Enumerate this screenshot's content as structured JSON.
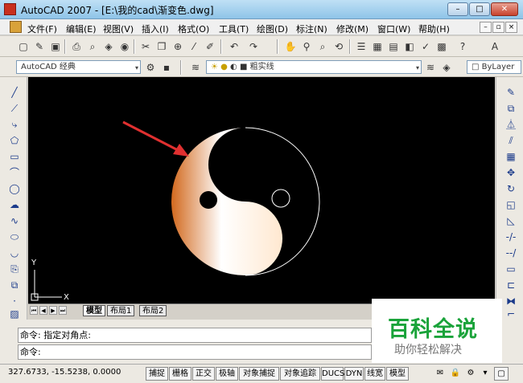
{
  "window": {
    "title": "AutoCAD 2007 - [E:\\我的cad\\渐变色.dwg]",
    "min_label": "–",
    "max_label": "□",
    "close_label": "✕"
  },
  "menu": [
    "文件(F)",
    "编辑(E)",
    "视图(V)",
    "插入(I)",
    "格式(O)",
    "工具(T)",
    "绘图(D)",
    "标注(N)",
    "修改(M)",
    "窗口(W)",
    "帮助(H)"
  ],
  "toolbar2": {
    "workspace": "AutoCAD 经典",
    "layer": "粗实线",
    "color": "ByLayer"
  },
  "tabs": [
    "模型",
    "布局1",
    "布局2"
  ],
  "ucs": {
    "y": "Y",
    "x": "X"
  },
  "command": {
    "history": "命令: 指定对角点:",
    "prompt": "命令:"
  },
  "status": {
    "coords": "327.6733,  -15.5238,  0.0000",
    "buttons": [
      "捕捉",
      "栅格",
      "正交",
      "极轴",
      "对象捕捉",
      "对象追踪",
      "DUCS",
      "DYN",
      "线宽",
      "模型"
    ]
  },
  "watermark": {
    "title": "百科全说",
    "subtitle": "助你轻松解决"
  },
  "colors": {
    "canvas": "#000000",
    "gradient_light": "#ffffff",
    "gradient_dark": "#d2691e",
    "arrow": "#e03030",
    "watermark_green": "#1aa33a"
  }
}
